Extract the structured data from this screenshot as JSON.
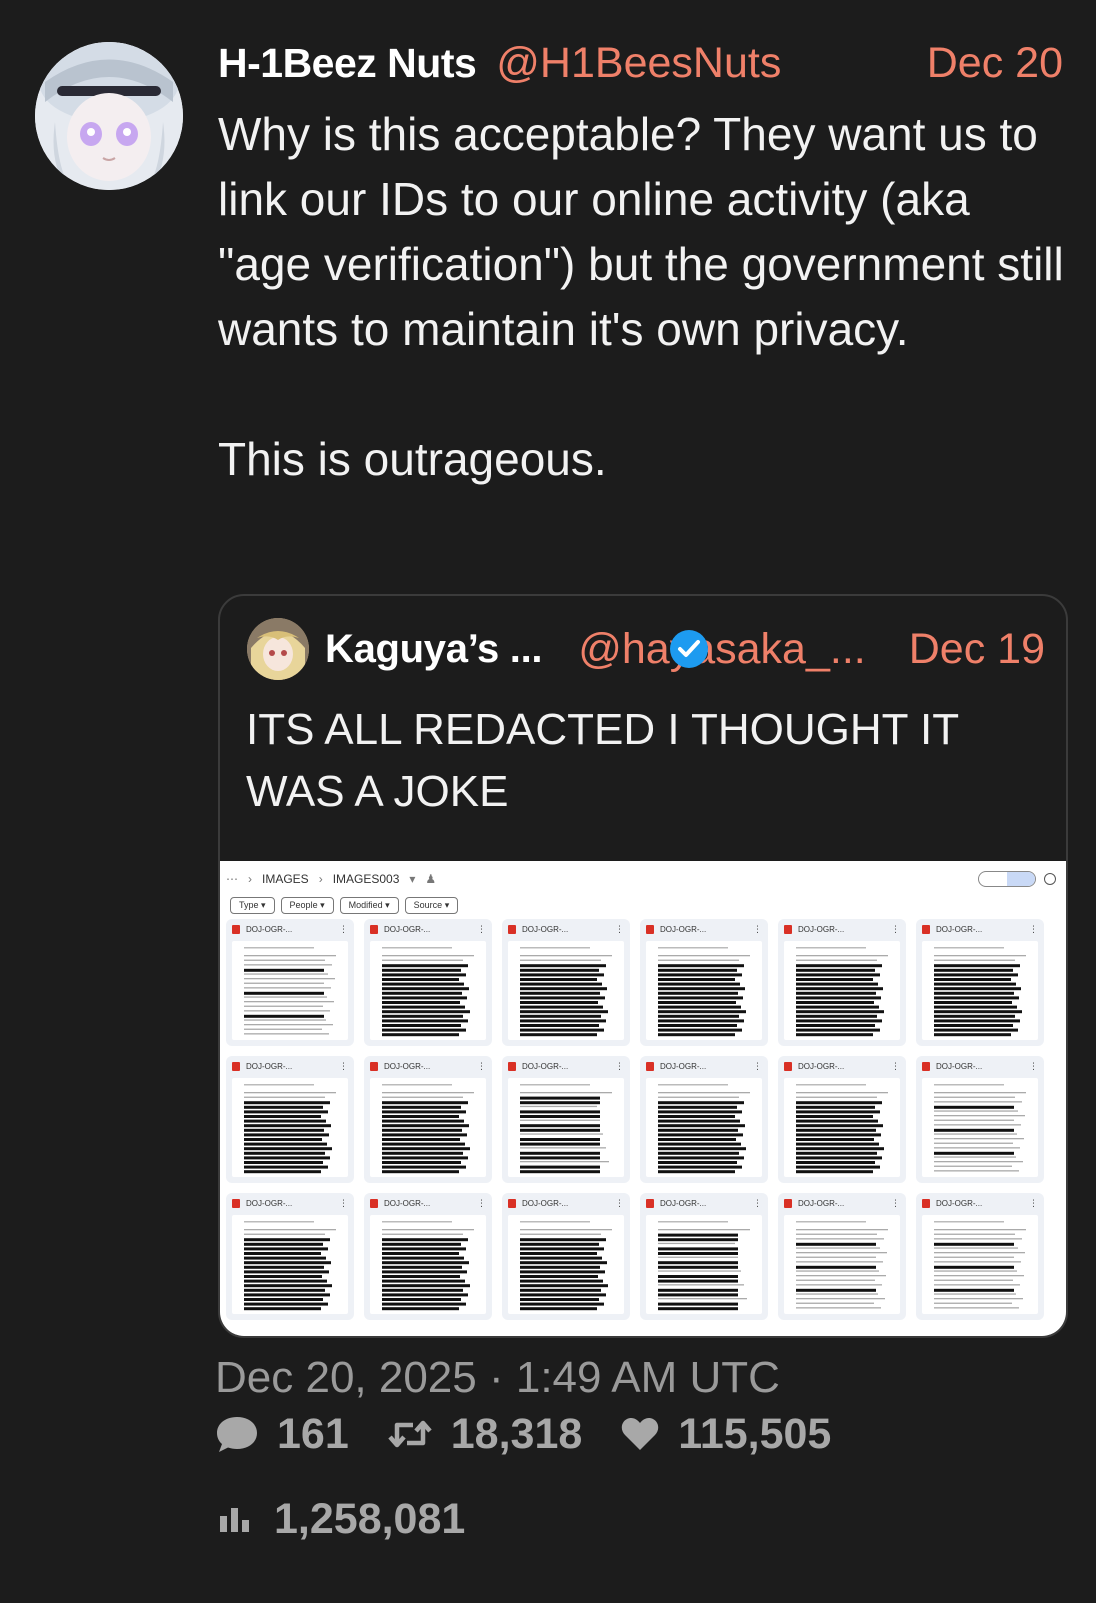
{
  "tweet": {
    "author_name": "H-1Beez Nuts",
    "handle": "@H1BeesNuts",
    "date": "Dec 20",
    "text": "Why is this acceptable? They want us to link our IDs to our online activity (aka \"age verification\") but the government still wants to maintain it's own privacy.\n\nThis is outrageous.",
    "timestamp": "Dec 20, 2025 · 1:49 AM UTC"
  },
  "quote": {
    "author_name": "Kaguya’s ...",
    "handle": "@hayasaka_...",
    "date": "Dec 19",
    "text": "ITS ALL REDACTED I THOUGHT IT WAS A JOKE",
    "verified": true
  },
  "screenshot": {
    "breadcrumb": [
      "IMAGES",
      "IMAGES003"
    ],
    "filters": [
      "Type",
      "People",
      "Modified",
      "Source"
    ],
    "files": [
      {
        "name": "DOJ-OGR-..."
      },
      {
        "name": "DOJ-OGR-..."
      },
      {
        "name": "DOJ-OGR-..."
      },
      {
        "name": "DOJ-OGR-..."
      },
      {
        "name": "DOJ-OGR-..."
      },
      {
        "name": "DOJ-OGR-..."
      },
      {
        "name": "DOJ-OGR-..."
      },
      {
        "name": "DOJ-OGR-..."
      },
      {
        "name": "DOJ-OGR-..."
      },
      {
        "name": "DOJ-OGR-..."
      },
      {
        "name": "DOJ-OGR-..."
      },
      {
        "name": "DOJ-OGR-..."
      },
      {
        "name": "DOJ-OGR-..."
      },
      {
        "name": "DOJ-OGR-..."
      },
      {
        "name": "DOJ-OGR-..."
      },
      {
        "name": "DOJ-OGR-..."
      },
      {
        "name": "DOJ-OGR-..."
      },
      {
        "name": "DOJ-OGR-..."
      }
    ]
  },
  "stats": {
    "replies": "161",
    "retweets": "18,318",
    "likes": "115,505",
    "views": "1,258,081"
  },
  "colors": {
    "background": "#1c1c1c",
    "accent": "#ef8069",
    "muted": "#9a9a9a",
    "verified": "#1d9bf0"
  },
  "icons": [
    "reply-icon",
    "retweet-icon",
    "like-icon",
    "views-icon",
    "verified-icon"
  ]
}
